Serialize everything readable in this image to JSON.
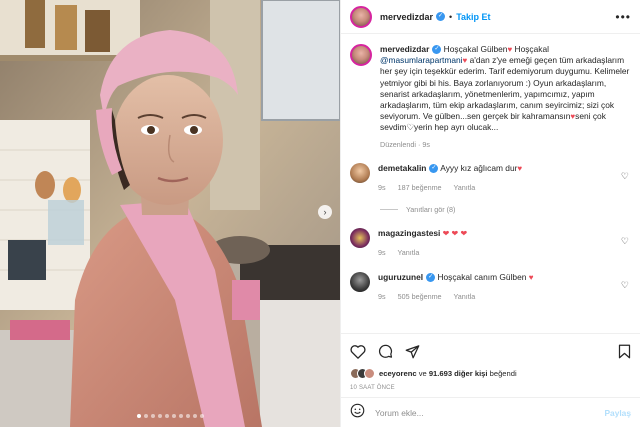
{
  "post": {
    "username": "mervedizdar",
    "follow_label": "Takip Et",
    "more_label": "•••"
  },
  "caption": {
    "username": "mervedizdar",
    "text_1": " Hoşçakal Gülben",
    "text_2": " Hoşçakal ",
    "mention": "@masumlarapartmani",
    "text_3": " a'dan z'ye emeği geçen tüm arkadaşlarım her şey için teşekkür ederim. Tarif edemiyorum duygumu. Kelimeler yetmiyor gibi bi his. Baya zorlanıyorum :) Oyun arkadaşlarım, senarist arkadaşlarım, yönetmenlerim, yapımcımız, yapım arkadaşlarım, tüm ekip arkadaşlarım, canım seyircimiz; sizi çok seviyorum. Ve gülben...sen gerçek bir kahramansın",
    "text_4": "seni çok sevdim",
    "text_5": "yerin hep ayrı olucak...",
    "edited": "Düzenlendi · 9s"
  },
  "comments": [
    {
      "username": "demetakalin",
      "verified": true,
      "text": " Ayyy kız ağlıcam dur",
      "time": "9s",
      "likes": "187 beğenme",
      "reply": "Yanıtla",
      "replies_label": "Yanıtları gör (8)"
    },
    {
      "username": "magazingastesi",
      "verified": false,
      "text": " ❤ ❤ ❤",
      "time": "9s",
      "reply": "Yanıtla"
    },
    {
      "username": "uguruzunel",
      "verified": true,
      "text": " Hoşçakal canım Gülben",
      "time": "9s",
      "likes": "505 beğenme",
      "reply": "Yanıtla"
    }
  ],
  "likes": {
    "prefix": "eceyorenc",
    "middle": " ve ",
    "count": "91.693 diğer kişi",
    "suffix": " beğendi"
  },
  "timestamp": "10 SAAT ÖNCE",
  "comment_box": {
    "placeholder": "Yorum ekle...",
    "post_label": "Paylaş"
  },
  "carousel": {
    "next_icon": "›",
    "dot_count": 10,
    "active_index": 0
  },
  "colors": {
    "accent": "#0095f6",
    "heart": "#ed4956",
    "verified": "#3897f0"
  },
  "icons": [
    "more-icon",
    "verified-icon",
    "heart-icon",
    "comment-icon",
    "share-icon",
    "bookmark-icon",
    "emoji-icon",
    "chevron-right-icon"
  ]
}
